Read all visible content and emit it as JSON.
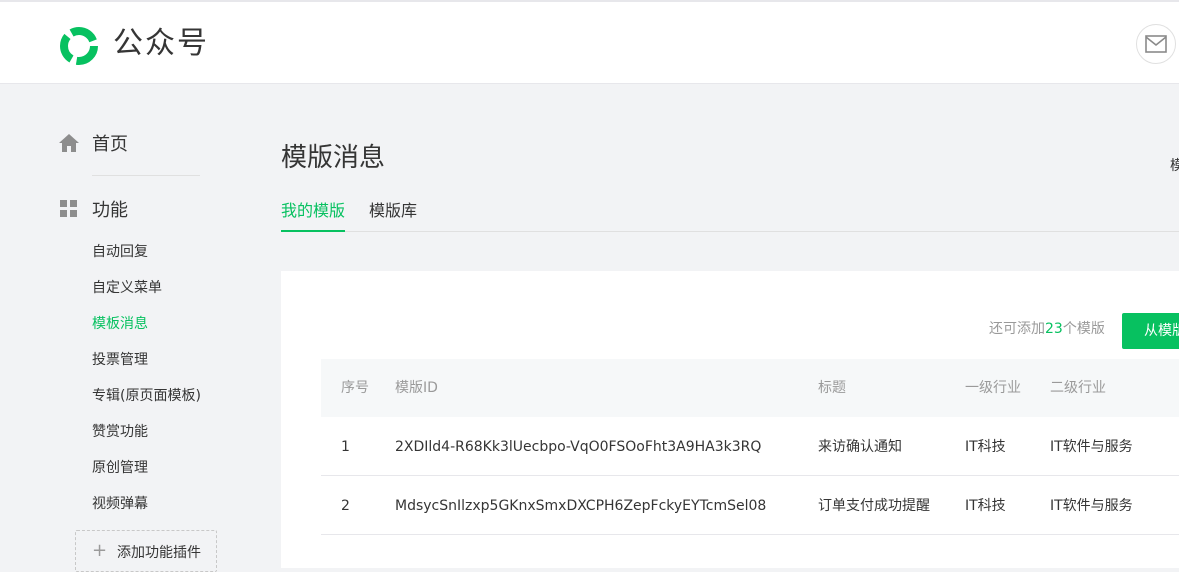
{
  "header": {
    "brand": "公众号",
    "brand_color": "#07c160"
  },
  "sidebar": {
    "home_label": "首页",
    "features_label": "功能",
    "items": [
      {
        "label": "自动回复",
        "active": false
      },
      {
        "label": "自定义菜单",
        "active": false
      },
      {
        "label": "模板消息",
        "active": true
      },
      {
        "label": "投票管理",
        "active": false
      },
      {
        "label": "专辑(原页面模板)",
        "active": false
      },
      {
        "label": "赞赏功能",
        "active": false
      },
      {
        "label": "原创管理",
        "active": false
      },
      {
        "label": "视频弹幕",
        "active": false
      }
    ],
    "add_plugin_label": "添加功能插件"
  },
  "main": {
    "title": "模版消息",
    "right_cut_text": "模",
    "tabs": [
      {
        "label": "我的模版",
        "active": true
      },
      {
        "label": "模版库",
        "active": false
      }
    ],
    "quota_prefix": "还可添加",
    "quota_count": "23",
    "quota_suffix": "个模版",
    "add_button_label": "从模版",
    "table": {
      "headers": [
        "序号",
        "模版ID",
        "标题",
        "一级行业",
        "二级行业"
      ],
      "rows": [
        {
          "index": "1",
          "template_id": "2XDIld4-R68Kk3lUecbpo-VqO0FSOoFht3A9HA3k3RQ",
          "title": "来访确认通知",
          "industry1": "IT科技",
          "industry2": "IT软件与服务"
        },
        {
          "index": "2",
          "template_id": "MdsycSnIlzxp5GKnxSmxDXCPH6ZepFckyEYTcmSel08",
          "title": "订单支付成功提醒",
          "industry1": "IT科技",
          "industry2": "IT软件与服务"
        }
      ]
    }
  }
}
